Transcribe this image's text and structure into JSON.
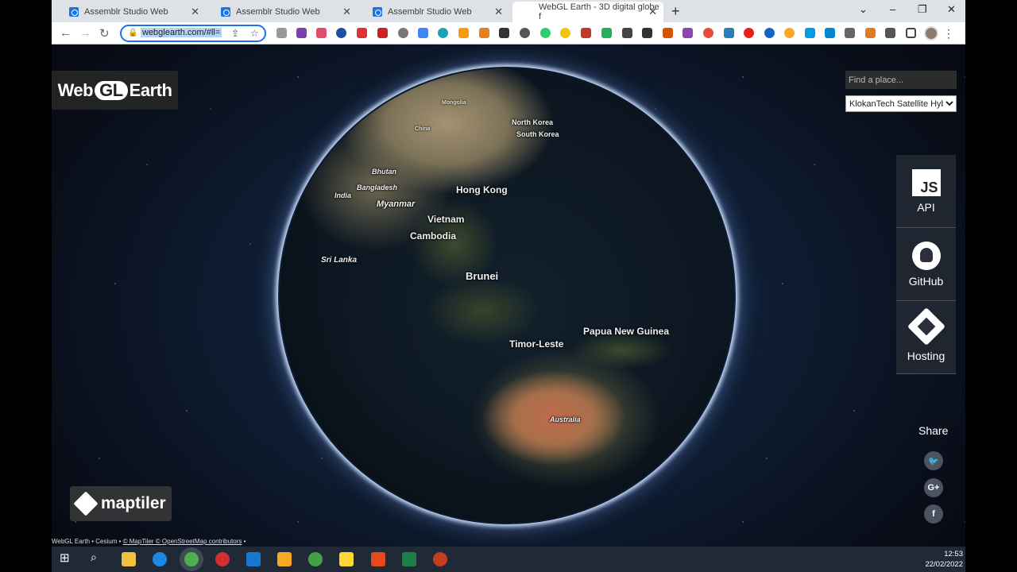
{
  "browser": {
    "tabs": [
      {
        "title": "Assemblr Studio Web",
        "active": false
      },
      {
        "title": "Assemblr Studio Web",
        "active": false
      },
      {
        "title": "Assemblr Studio Web",
        "active": false
      },
      {
        "title": "WebGL Earth - 3D digital globe f",
        "active": true
      }
    ],
    "url": "webglearth.com/#ll=",
    "window_controls": {
      "minimize": "–",
      "maximize": "❐",
      "close": "✕",
      "tab_search": "⌄"
    }
  },
  "app": {
    "logo_web": "Web",
    "logo_gl": "GL",
    "logo_earth": "Earth",
    "search_placeholder": "Find a place...",
    "layer_selected": "KlokanTech Satellite Hybrid",
    "side_buttons": [
      {
        "label": "API",
        "icon": "js-icon"
      },
      {
        "label": "GitHub",
        "icon": "github-icon"
      },
      {
        "label": "Hosting",
        "icon": "hosting-icon"
      }
    ],
    "share_label": "Share",
    "share_buttons": [
      {
        "icon": "twitter-icon",
        "glyph": "🐦"
      },
      {
        "icon": "google-plus-icon",
        "glyph": "G+"
      },
      {
        "icon": "facebook-icon",
        "glyph": "f"
      }
    ],
    "maptiler_logo": "maptiler",
    "attribution": {
      "prefix": "WebGL Earth • Cesium • ",
      "link": "© MapTiler © OpenStreetMap contributors",
      "suffix": " •"
    }
  },
  "map_labels": [
    {
      "text": "Mongolia",
      "size": "small"
    },
    {
      "text": "North Korea",
      "size": "small"
    },
    {
      "text": "South Korea",
      "size": "small"
    },
    {
      "text": "China",
      "size": "small"
    },
    {
      "text": "Bhutan",
      "size": "small"
    },
    {
      "text": "India",
      "size": "small"
    },
    {
      "text": "Bangladesh",
      "size": "small"
    },
    {
      "text": "Hong Kong",
      "size": "medium"
    },
    {
      "text": "Myanmar",
      "size": "medium"
    },
    {
      "text": "Vietnam",
      "size": "medium"
    },
    {
      "text": "Cambodia",
      "size": "medium"
    },
    {
      "text": "Sri Lanka",
      "size": "small"
    },
    {
      "text": "Brunei",
      "size": "large"
    },
    {
      "text": "Papua New Guinea",
      "size": "medium"
    },
    {
      "text": "Timor-Leste",
      "size": "medium"
    },
    {
      "text": "Australia",
      "size": "small"
    }
  ],
  "taskbar": {
    "time": "12:53",
    "date": "22/02/2022"
  },
  "colors": {
    "accent": "#1a73e8",
    "taskbar": "#202a36",
    "space": "#0b0f17"
  }
}
